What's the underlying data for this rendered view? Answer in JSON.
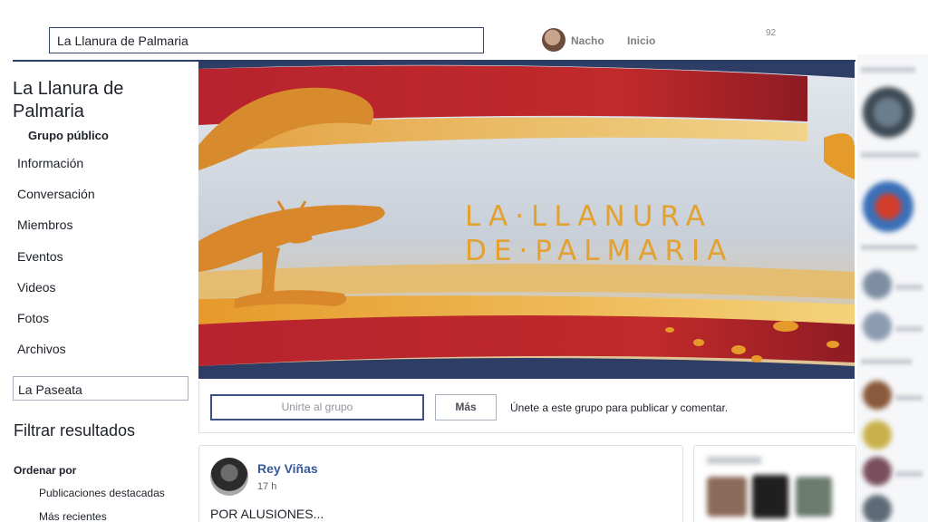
{
  "topbar": {
    "search_value": "La Llanura de Palmaria",
    "user_name": "Nacho",
    "home_label": "Inicio",
    "notification_count": "92"
  },
  "group": {
    "title": "La Llanura de Palmaria",
    "privacy": "Grupo público",
    "cover_text_line1": "LA·LLANURA",
    "cover_text_line2": "DE·PALMARIA"
  },
  "sidebar": {
    "items": [
      {
        "label": "Información"
      },
      {
        "label": "Conversación"
      },
      {
        "label": "Miembros"
      },
      {
        "label": "Eventos"
      },
      {
        "label": "Videos"
      },
      {
        "label": "Fotos"
      },
      {
        "label": "Archivos"
      }
    ],
    "search_value": "La Paseata",
    "filter_title": "Filtrar resultados",
    "order_label": "Ordenar por",
    "order_options": [
      "Publicaciones destacadas",
      "Más recientes"
    ]
  },
  "join": {
    "join_button": "Unirte al grupo",
    "more_button": "Más",
    "hint": "Únete a este grupo para publicar y comentar."
  },
  "post": {
    "author": "Rey Viñas",
    "time": "17 h",
    "text": "POR ALUSIONES..."
  },
  "colors": {
    "brand_navy": "#2e3d66",
    "link_blue": "#365899",
    "cover_red": "#b0222e",
    "cover_gold": "#e3a12f"
  },
  "icons": [
    "user-avatar-icon",
    "bull-tree-logo"
  ]
}
